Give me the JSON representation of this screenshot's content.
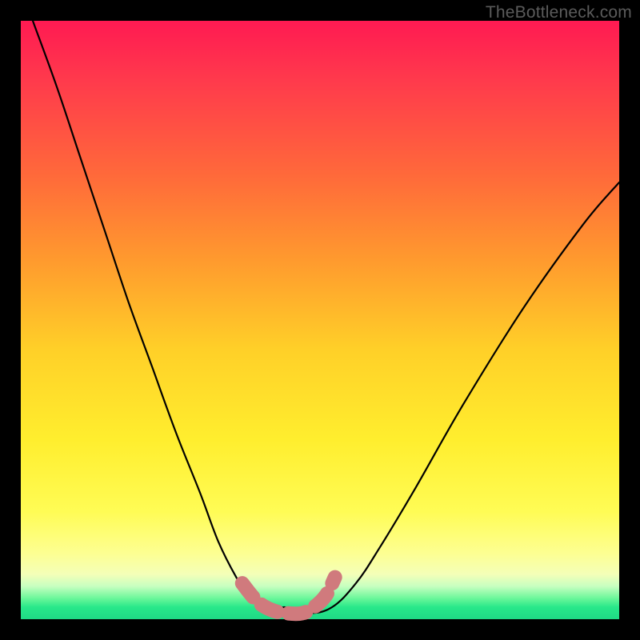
{
  "watermark": "TheBottleneck.com",
  "colors": {
    "page_bg": "#000000",
    "curve": "#000000",
    "dash": "#d07a7d"
  },
  "chart_data": {
    "type": "line",
    "title": "",
    "xlabel": "",
    "ylabel": "",
    "xlim": [
      0,
      100
    ],
    "ylim": [
      0,
      100
    ],
    "series": [
      {
        "name": "bottleneck-curve",
        "x": [
          2,
          6,
          10,
          14,
          18,
          22,
          26,
          30,
          33,
          36,
          38,
          40,
          42,
          44,
          48,
          52,
          56,
          60,
          66,
          74,
          84,
          94,
          100
        ],
        "y": [
          100,
          89,
          77,
          65,
          53,
          42,
          31,
          21,
          13,
          7,
          4,
          2,
          1,
          2,
          1,
          2,
          6,
          12,
          22,
          36,
          52,
          66,
          73
        ]
      }
    ],
    "annotations": [
      {
        "name": "optimal-flat-region",
        "style": "dashed",
        "points_x": [
          37,
          39.5,
          42,
          44.5,
          47,
          49,
          51,
          52.5
        ],
        "points_y": [
          6,
          3,
          1.5,
          1,
          1,
          2,
          4,
          7
        ]
      }
    ]
  }
}
